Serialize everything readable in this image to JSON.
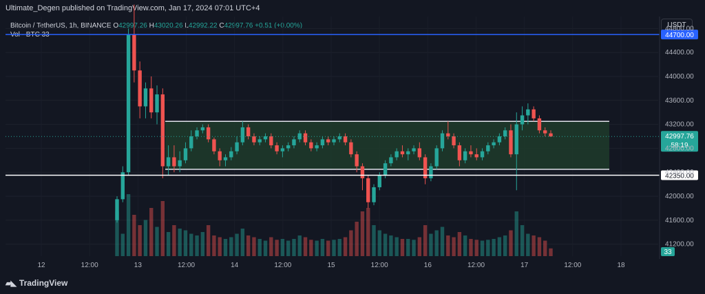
{
  "header": {
    "published": "Ultimate_Degen published on TradingView.com, Jan 17, 2024 07:01 UTC+4"
  },
  "legend": {
    "symbol": "Bitcoin / TetherUS, 1h, BINANCE",
    "o_label": "O",
    "o_value": "42997.26",
    "h_label": "H",
    "h_value": "43020.26",
    "l_label": "L",
    "l_value": "42992.22",
    "c_label": "C",
    "c_value": "42997.76",
    "change": "+0.51 (+0.00%)",
    "vol_label": "Vol · BTC",
    "vol_value": "33"
  },
  "currency_button": "USDT",
  "footer": {
    "brand": "TradingView",
    "logo": "tradingview-logo-icon"
  },
  "colors": {
    "background": "#131722",
    "up": "#26a69a",
    "down": "#ef5350",
    "resistance_line": "#2962ff",
    "support_line": "#ffffff",
    "zone_fill": "#1f3b2a",
    "price_badge": "#26a69a"
  },
  "chart_data": {
    "type": "candlestick",
    "symbol": "BTCUSDT",
    "timeframe": "1h",
    "x_tick_labels": [
      "12",
      "12:00",
      "13",
      "12:00",
      "14",
      "12:00",
      "15",
      "12:00",
      "16",
      "12:00",
      "17",
      "12:00",
      "18"
    ],
    "y_tick_labels": [
      "44800.00",
      "44400.00",
      "44000.00",
      "43600.00",
      "43200.00",
      "42800.00",
      "42400.00",
      "42000.00",
      "41600.00",
      "41200.00"
    ],
    "y_ticks": [
      44800,
      44400,
      44000,
      43600,
      43200,
      42800,
      42400,
      42000,
      41600,
      41200
    ],
    "ylim": [
      41000,
      45000
    ],
    "horizontal_lines": [
      {
        "label": "44700.00",
        "value": 44700,
        "color": "#2962ff"
      },
      {
        "label": "42350.00",
        "value": 42350,
        "color": "#ffffff"
      }
    ],
    "range_zone": {
      "top": 43250,
      "bottom": 42450
    },
    "current_price": {
      "label": "42997.76",
      "value": 42997.76,
      "countdown": "58:19"
    },
    "volume_badge": "33",
    "candles": [
      [
        41600,
        42000,
        41560,
        41950
      ],
      [
        41950,
        42500,
        41900,
        42400
      ],
      [
        42400,
        44800,
        42350,
        44700
      ],
      [
        44700,
        45200,
        43900,
        44100
      ],
      [
        44100,
        44250,
        43300,
        43500
      ],
      [
        43500,
        43900,
        43300,
        43800
      ],
      [
        43800,
        44000,
        43300,
        43400
      ],
      [
        43400,
        43850,
        43200,
        43700
      ],
      [
        43700,
        43800,
        42300,
        42500
      ],
      [
        42500,
        42850,
        42350,
        42650
      ],
      [
        42650,
        42850,
        42400,
        42500
      ],
      [
        42500,
        42750,
        42400,
        42600
      ],
      [
        42600,
        42900,
        42550,
        42800
      ],
      [
        42800,
        43100,
        42750,
        43000
      ],
      [
        43000,
        43150,
        42950,
        43100
      ],
      [
        43100,
        43200,
        43050,
        43150
      ],
      [
        43150,
        43200,
        42900,
        42950
      ],
      [
        42950,
        42980,
        42700,
        42750
      ],
      [
        42750,
        42800,
        42500,
        42600
      ],
      [
        42600,
        42700,
        42500,
        42650
      ],
      [
        42650,
        42820,
        42600,
        42750
      ],
      [
        42750,
        43000,
        42700,
        42900
      ],
      [
        42900,
        43250,
        42850,
        43150
      ],
      [
        43150,
        43200,
        42950,
        43000
      ],
      [
        43000,
        43050,
        42850,
        42900
      ],
      [
        42900,
        43000,
        42850,
        42950
      ],
      [
        42950,
        43050,
        42900,
        43000
      ],
      [
        43000,
        43050,
        42800,
        42850
      ],
      [
        42850,
        42900,
        42700,
        42750
      ],
      [
        42750,
        42850,
        42650,
        42800
      ],
      [
        42800,
        42900,
        42750,
        42850
      ],
      [
        42850,
        43000,
        42800,
        42950
      ],
      [
        42950,
        43100,
        42900,
        43050
      ],
      [
        43050,
        43100,
        42850,
        42900
      ],
      [
        42900,
        42950,
        42750,
        42800
      ],
      [
        42800,
        42900,
        42750,
        42850
      ],
      [
        42850,
        43000,
        42800,
        42950
      ],
      [
        42950,
        43000,
        42850,
        42900
      ],
      [
        42900,
        43000,
        42850,
        42950
      ],
      [
        42950,
        43050,
        42900,
        43000
      ],
      [
        43000,
        43050,
        42850,
        42900
      ],
      [
        42900,
        42950,
        42650,
        42700
      ],
      [
        42700,
        42750,
        42400,
        42500
      ],
      [
        42500,
        42550,
        42100,
        42300
      ],
      [
        42300,
        42350,
        41800,
        41900
      ],
      [
        41900,
        42200,
        41850,
        42150
      ],
      [
        42150,
        42400,
        42100,
        42350
      ],
      [
        42350,
        42600,
        42300,
        42550
      ],
      [
        42550,
        42700,
        42500,
        42650
      ],
      [
        42650,
        42800,
        42600,
        42750
      ],
      [
        42750,
        42850,
        42650,
        42700
      ],
      [
        42700,
        42800,
        42600,
        42750
      ],
      [
        42750,
        42850,
        42700,
        42800
      ],
      [
        42800,
        42900,
        42600,
        42650
      ],
      [
        42650,
        42700,
        42200,
        42300
      ],
      [
        42300,
        42550,
        42250,
        42500
      ],
      [
        42500,
        42850,
        42450,
        42800
      ],
      [
        42800,
        43100,
        42750,
        43050
      ],
      [
        43050,
        43250,
        42950,
        43000
      ],
      [
        43000,
        43050,
        42800,
        42850
      ],
      [
        42850,
        42900,
        42500,
        42600
      ],
      [
        42600,
        42800,
        42550,
        42750
      ],
      [
        42750,
        42850,
        42650,
        42700
      ],
      [
        42700,
        42800,
        42600,
        42650
      ],
      [
        42650,
        42800,
        42600,
        42750
      ],
      [
        42750,
        42900,
        42700,
        42850
      ],
      [
        42850,
        42950,
        42800,
        42900
      ],
      [
        42900,
        43050,
        42850,
        43000
      ],
      [
        43000,
        43150,
        42950,
        43100
      ],
      [
        43100,
        43200,
        42650,
        42700
      ],
      [
        42700,
        43400,
        42100,
        43200
      ],
      [
        43200,
        43500,
        43100,
        43350
      ],
      [
        43350,
        43550,
        43200,
        43450
      ],
      [
        43450,
        43500,
        43250,
        43300
      ],
      [
        43300,
        43350,
        43050,
        43100
      ],
      [
        43100,
        43150,
        43000,
        43050
      ],
      [
        43050,
        43100,
        42990,
        42998
      ]
    ],
    "volumes": [
      260,
      130,
      360,
      240,
      180,
      210,
      280,
      170,
      320,
      140,
      180,
      160,
      150,
      130,
      120,
      140,
      180,
      120,
      110,
      100,
      110,
      130,
      160,
      120,
      110,
      100,
      90,
      110,
      95,
      100,
      90,
      100,
      120,
      110,
      95,
      90,
      100,
      90,
      95,
      100,
      110,
      150,
      200,
      260,
      280,
      180,
      150,
      130,
      120,
      110,
      100,
      100,
      95,
      110,
      180,
      130,
      150,
      170,
      120,
      110,
      140,
      120,
      100,
      95,
      90,
      95,
      100,
      110,
      120,
      150,
      260,
      180,
      130,
      120,
      110,
      90,
      45
    ]
  }
}
